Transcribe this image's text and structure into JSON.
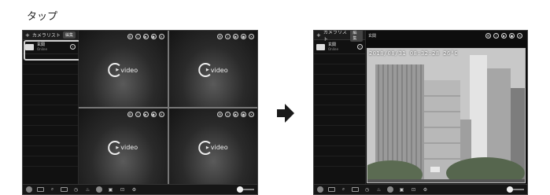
{
  "caption": "タップ",
  "left_view": {
    "sidebar": {
      "title": "カメラリスト",
      "edit_label": "編集",
      "cameras": [
        {
          "name": "玄関",
          "sub": "Online"
        }
      ]
    },
    "cells": [
      {
        "logo_text": "video"
      },
      {
        "logo_text": "video"
      },
      {
        "logo_text": "video"
      },
      {
        "logo_text": "video"
      }
    ]
  },
  "right_view": {
    "sidebar": {
      "title": "カメラリスト",
      "edit_label": "編集",
      "cameras": [
        {
          "name": "玄関",
          "sub": "Online"
        }
      ]
    },
    "top_title": "玄関",
    "timestamp": "2018/08/31 08:32:28 26°C"
  },
  "colors": {
    "background": "#0b0b0b",
    "highlight": "#cfcfcf",
    "arrow": "#1a1a1a"
  },
  "icons": [
    "plus-icon",
    "info-icon",
    "play-icon",
    "record-icon",
    "snapshot-icon",
    "grid-icon",
    "search-icon",
    "settings-icon",
    "arrow-right-icon"
  ]
}
